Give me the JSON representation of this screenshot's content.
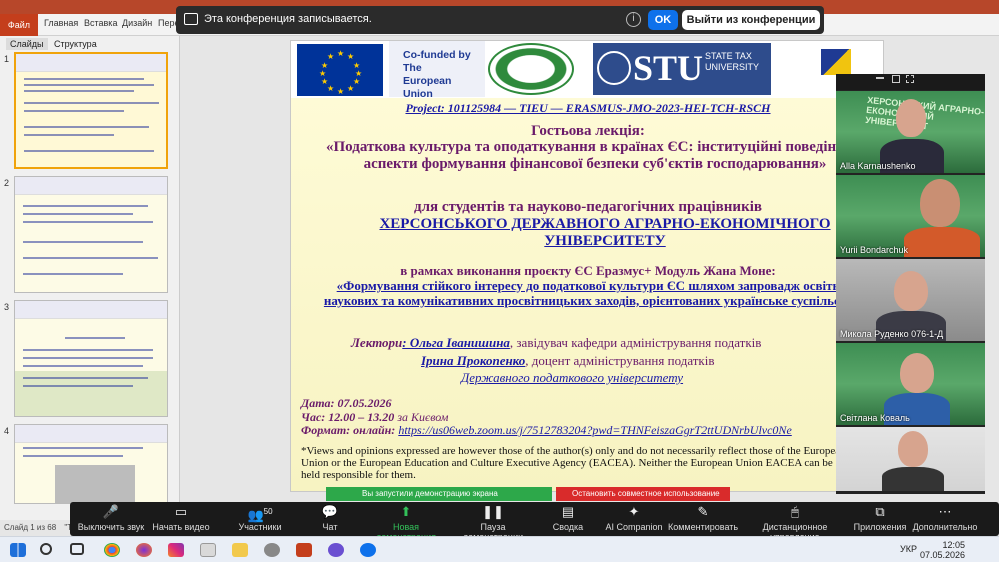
{
  "powerpoint": {
    "file_tab": "Файл",
    "tabs": [
      "Главная",
      "Вставка",
      "Дизайн",
      "Пере"
    ],
    "pane_tabs": [
      "Слайды",
      "Структура"
    ],
    "slide_numbers": [
      "1",
      "2",
      "3",
      "4"
    ],
    "status": "Слайд 1 из 68",
    "status_extra": "\"Те"
  },
  "zoom": {
    "recording_text": "Эта конференция записывается.",
    "ok_label": "OK",
    "leave_label": "Выйти из конференции",
    "sharing_text": "Вы запустили демонстрацию экрана",
    "stop_share_label": "Остановить совместное использование",
    "participants_count": "50",
    "toolbar": [
      {
        "label": "Выключить звук",
        "icon": "microphone-icon"
      },
      {
        "label": "Начать видео",
        "icon": "video-off-icon"
      },
      {
        "label": "Участники",
        "icon": "participants-icon"
      },
      {
        "label": "Чат",
        "icon": "chat-icon"
      },
      {
        "label": "Новая демонстрация",
        "icon": "share-screen-icon"
      },
      {
        "label": "Пауза демонстрации",
        "icon": "pause-icon"
      },
      {
        "label": "Сводка",
        "icon": "summary-icon"
      },
      {
        "label": "AI Companion",
        "icon": "ai-companion-icon"
      },
      {
        "label": "Комментировать",
        "icon": "annotate-icon"
      },
      {
        "label": "Дистанционное управление",
        "icon": "remote-control-icon"
      },
      {
        "label": "Приложения",
        "icon": "apps-icon"
      },
      {
        "label": "Дополнительно",
        "icon": "more-icon"
      }
    ],
    "participants": [
      {
        "name": "Alla Karnaushenko"
      },
      {
        "name": "Yurii  Bondarchuk"
      },
      {
        "name": "Микола Руденко 076-1-Д"
      },
      {
        "name": "Світлана Коваль"
      },
      {
        "name": ""
      }
    ],
    "background_text": "ХЕРСОНСЬКИЙ АГРАРНО-ЕКОНОМІЧНИЙ УНІВЕРСИТЕТ"
  },
  "slide": {
    "cofunded": "Co-funded by The European Union",
    "stu_big": "STU",
    "stu_small": "STATE TAX UNIVERSITY",
    "project": "Project: 101125984 — TIEU — ERASMUS-JMO-2023-HEI-TCH-RSCH",
    "lecture_kind": "Гостьова лекція:",
    "title": "«Податкова культура та оподаткування в країнах ЄС: інституційні поведінкові аспекти формування фінансової безпеки суб'єктів господарювання»",
    "audience": "для студентів та науково-педагогічних працівників",
    "university": "ХЕРСОНСЬКОГО ДЕРЖАВНОГО АГРАРНО-ЕКОНОМІЧНОГО УНІВЕРСИТЕТУ",
    "within": "в рамках виконання проєкту ЄС Еразмус+ Модуль Жана Моне:",
    "project_title": "«Формування стійкого інтересу до податкової культури ЄС шляхом запровадж освітніх, наукових та комунікативних просвітницьких заходів, орієнтованих українське суспільство»",
    "lecturers_label": "Лектори",
    "lecturer1": ": Ольга Іванишина",
    "lecturer1_role": ", завідувач кафедри адміністрування податків",
    "lecturer2": "Ірина Прокопенко",
    "lecturer2_role": ",  доцент адміністрування  податків",
    "org": "Державного податкового університету",
    "date": "Дата: 07.05.2026",
    "time_label": "Час:  12.00 – 13.20",
    "time_tz": " за Києвом",
    "format_label": "Формат: онлайн: ",
    "link": "https://us06web.zoom.us/j/7512783204?pwd=THNFeiszaGgrT2ttUDNrbUlvc0Ne",
    "disclaimer": "*Views and opinions expressed are however those of the author(s) only and do not necessarily reflect those of the European Union or the European Education and Culture Executive Agency (EACEA). Neither the European Union EACEA can be held responsible for them."
  },
  "taskbar": {
    "lang": "УКР",
    "time": "12:05",
    "date": "07.05.2026"
  }
}
